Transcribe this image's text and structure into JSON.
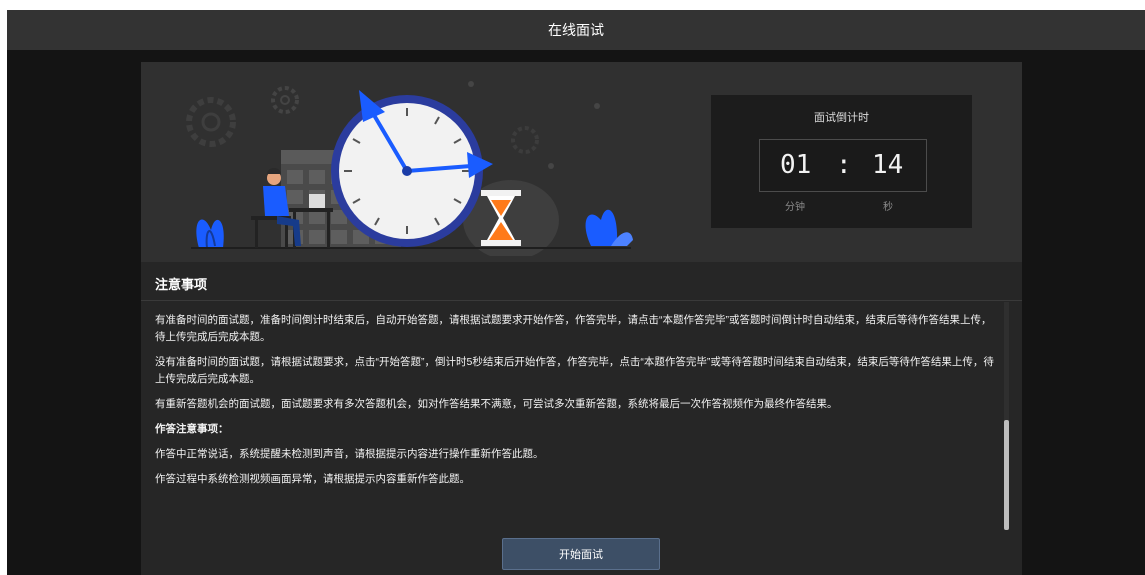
{
  "window": {
    "title": "在线面试"
  },
  "countdown": {
    "title": "面试倒计时",
    "minutes": "01",
    "separator": ":",
    "seconds": "14",
    "minutes_unit": "分钟",
    "seconds_unit": "秒"
  },
  "notes": {
    "heading": "注意事项",
    "paragraphs": [
      "有准备时间的面试题，准备时间倒计时结束后，自动开始答题，请根据试题要求开始作答，作答完毕，请点击“本题作答完毕”或答题时间倒计时自动结束，结束后等待作答结果上传，待上传完成后完成本题。",
      "没有准备时间的面试题，请根据试题要求，点击“开始答题”，倒计时5秒结束后开始作答，作答完毕，点击“本题作答完毕”或等待答题时间结束自动结束，结束后等待作答结果上传，待上传完成后完成本题。",
      "有重新答题机会的面试题，面试题要求有多次答题机会，如对作答结果不满意，可尝试多次重新答题，系统将最后一次作答视频作为最终作答结果。"
    ],
    "subheading": "作答注意事项：",
    "tips": [
      "作答中正常说话，系统提醒未检测到声音，请根据提示内容进行操作重新作答此题。",
      "作答过程中系统检测视频画面异常，请根据提示内容重新作答此题。"
    ]
  },
  "actions": {
    "start_label": "开始面试"
  },
  "illustration": {
    "icon": "interview-timer-illustration"
  },
  "colors": {
    "accent_blue": "#1a5cff",
    "hourglass_orange": "#ff7a1a",
    "button_bg": "#3d4f66"
  }
}
